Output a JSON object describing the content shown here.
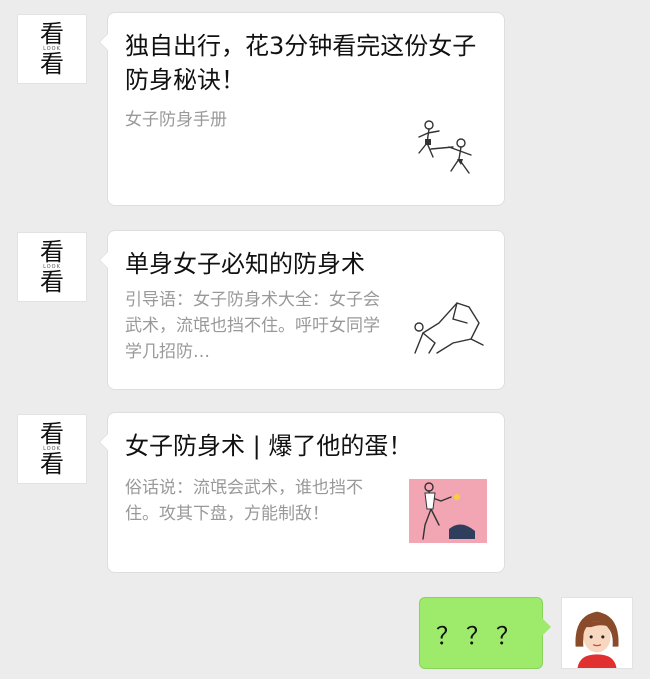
{
  "sender": {
    "avatar_char": "看",
    "avatar_brand": "LOOK"
  },
  "messages": [
    {
      "title": "独自出行，花3分钟看完这份女子防身秘诀！",
      "desc": "女子防身手册"
    },
    {
      "title": "单身女子必知的防身术",
      "desc": "引导语：女子防身术大全：女子会武术，流氓也挡不住。呼吁女同学学几招防…"
    },
    {
      "title": "女子防身术 | 爆了他的蛋！",
      "desc": "俗话说：流氓会武术，谁也挡不住。攻其下盘，方能制敌！"
    }
  ],
  "reply": {
    "text": "？？？"
  },
  "colors": {
    "background": "#ececec",
    "my_bubble": "#9eea6a",
    "thumb3_bg": "#f2a6b3"
  }
}
